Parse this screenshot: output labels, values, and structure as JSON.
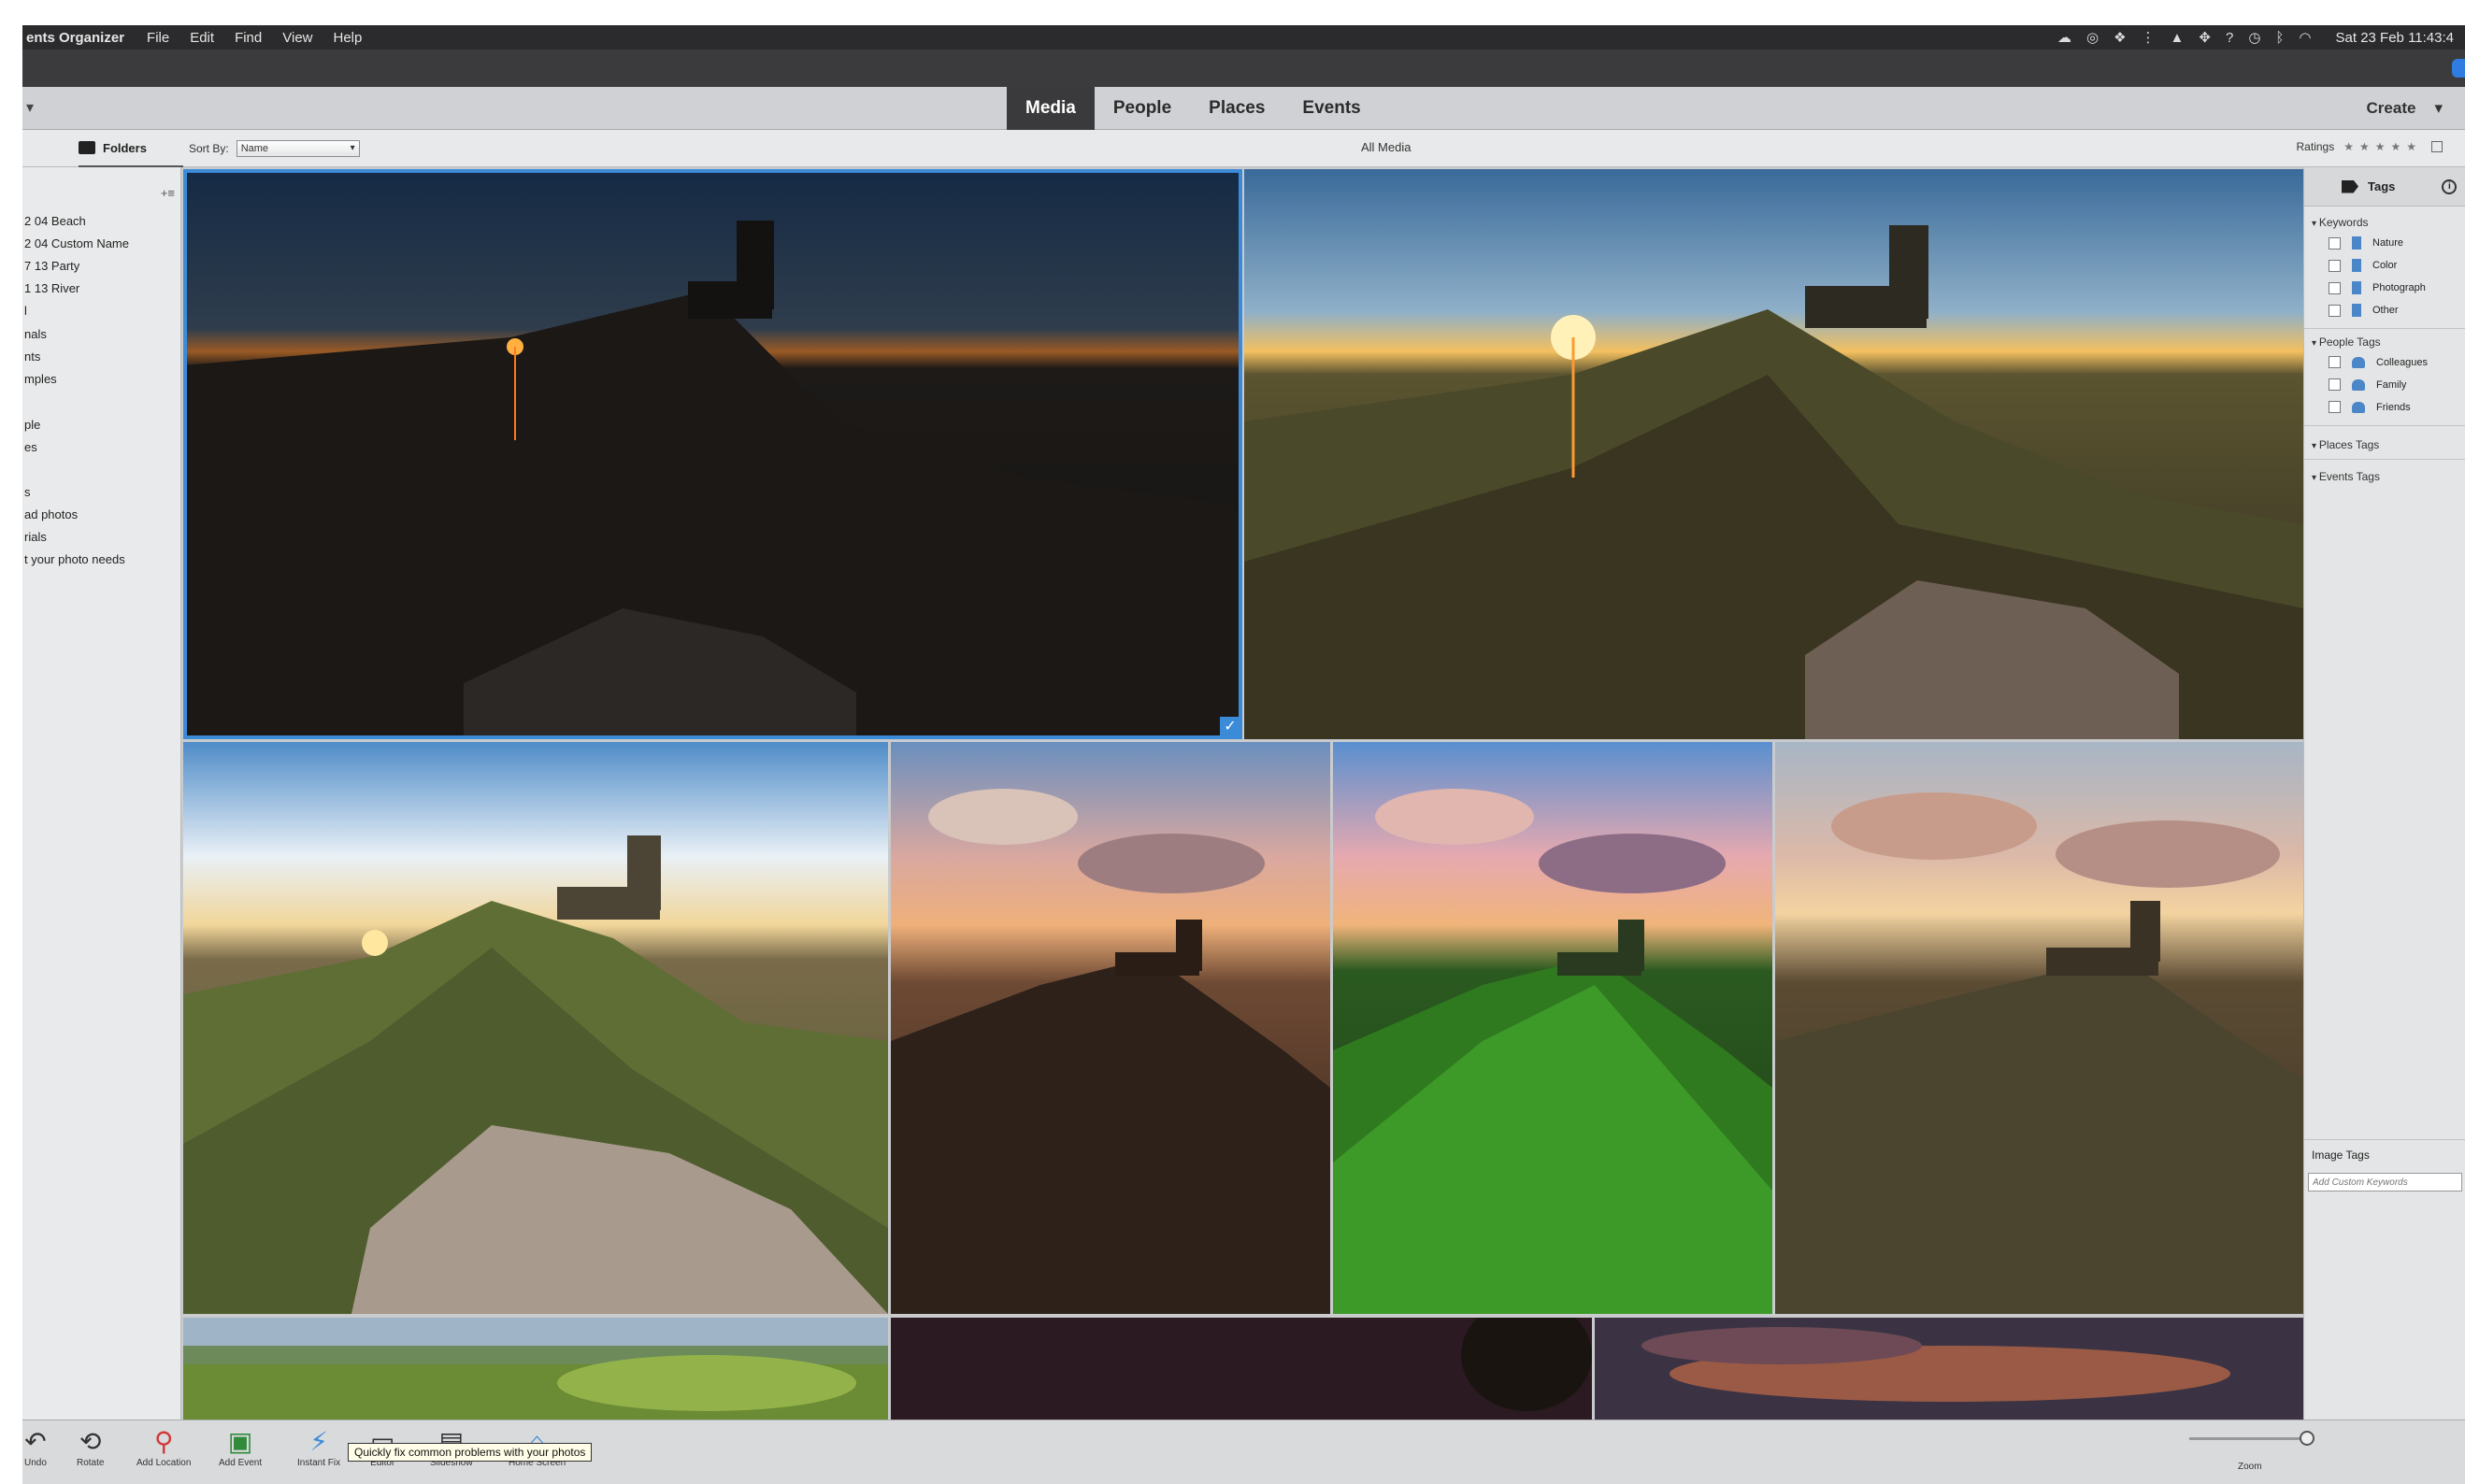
{
  "menubar": {
    "app_name": "ents Organizer",
    "menus": [
      "File",
      "Edit",
      "Find",
      "View",
      "Help"
    ],
    "clock": "Sat 23 Feb  11:43:4"
  },
  "modes": {
    "tabs": [
      "Media",
      "People",
      "Places",
      "Events"
    ],
    "active": "Media",
    "create_label": "Create"
  },
  "sortbar": {
    "folders_label": "Folders",
    "sort_by_label": "Sort By:",
    "sort_value": "Name",
    "all_media": "All Media",
    "ratings_label": "Ratings"
  },
  "left_panel": {
    "items": [
      "2 04 Beach",
      "2 04 Custom Name",
      "7 13 Party",
      "1 13 River",
      "l",
      "nals",
      "nts",
      "mples",
      "ple",
      "es",
      "s",
      "ad photos",
      "rials",
      "t your photo needs"
    ]
  },
  "right_panel": {
    "tab_label": "Tags",
    "keywords_label": "Keywords",
    "keywords": [
      "Nature",
      "Color",
      "Photograph",
      "Other"
    ],
    "people_tags_label": "People Tags",
    "people_tags": [
      "Colleagues",
      "Family",
      "Friends"
    ],
    "places_tags_label": "Places Tags",
    "events_tags_label": "Events Tags",
    "image_tags_label": "Image Tags",
    "keyword_placeholder": "Add Custom Keywords"
  },
  "toolbar": {
    "undo_label": "Undo",
    "rotate_label": "Rotate",
    "add_location_label": "Add Location",
    "add_event_label": "Add Event",
    "instant_fix_label": "Instant Fix",
    "editor_label": "Editor",
    "slideshow_label": "Slideshow",
    "home_screen_label": "Home Screen",
    "tooltip": "Quickly fix common problems with your photos",
    "zoom_label": "Zoom"
  },
  "colors": {
    "accent": "#3b8bd9",
    "active_tab": "#3a3a3c"
  }
}
